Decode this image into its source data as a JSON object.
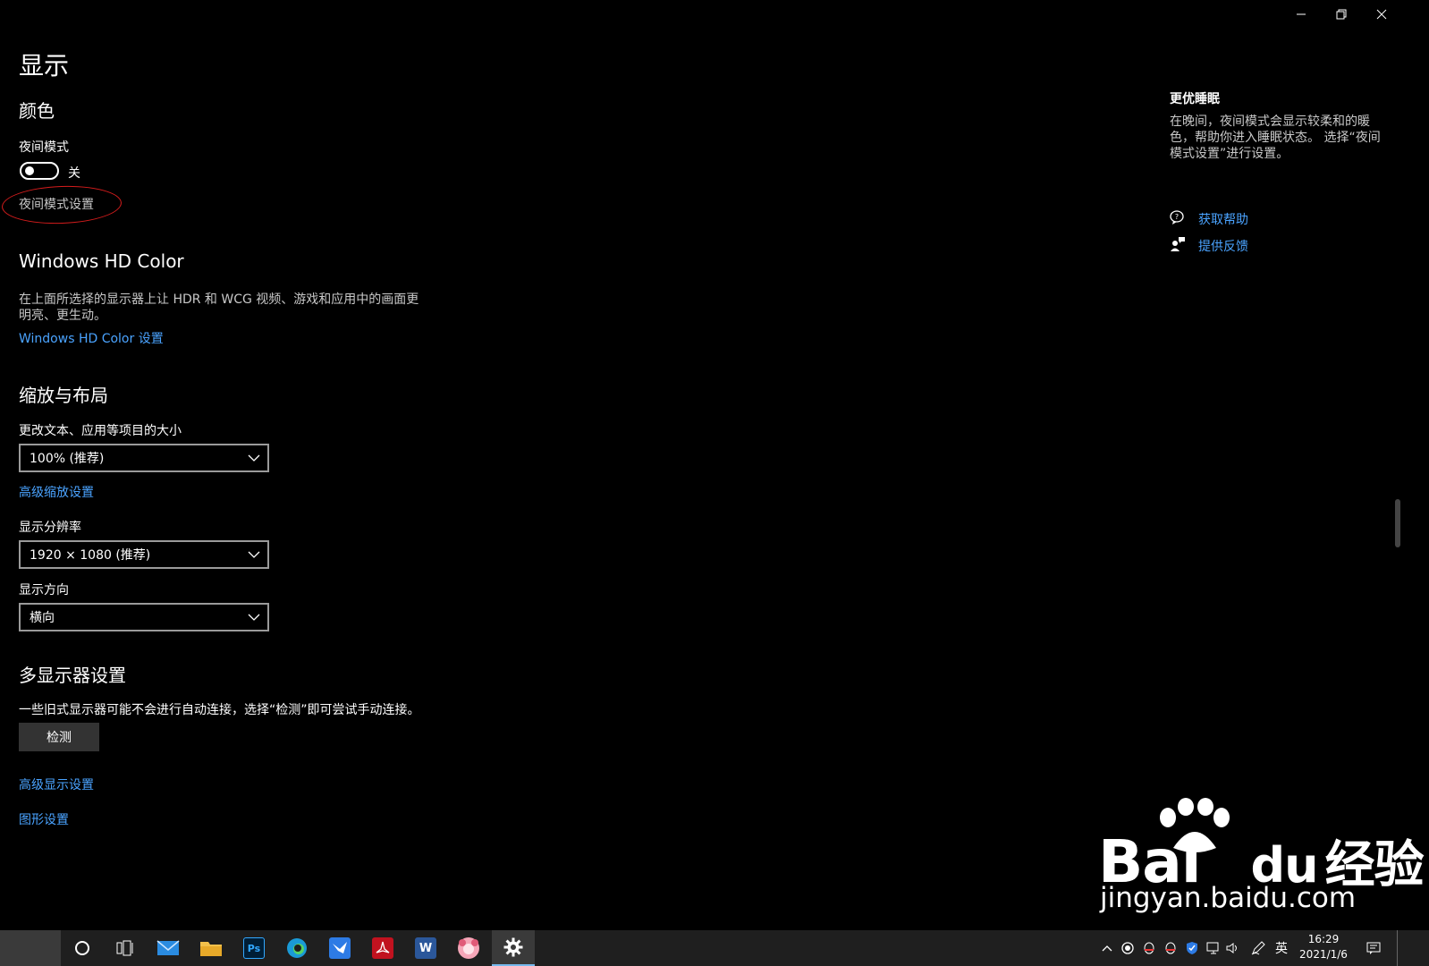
{
  "window": {
    "minimize_icon": "minimize-icon",
    "restore_icon": "restore-icon",
    "close_icon": "close-icon"
  },
  "page": {
    "title": "显示"
  },
  "color_section": {
    "heading": "颜色",
    "night_mode_label": "夜间模式",
    "night_mode_state": "关",
    "night_mode_settings_link": "夜间模式设置"
  },
  "hdr_section": {
    "heading": "Windows HD Color",
    "description_line1": "在上面所选择的显示器上让 HDR 和 WCG 视频、游戏和应用中的画面更",
    "description_line2": "明亮、更生动。",
    "settings_link": "Windows HD Color 设置"
  },
  "scale_section": {
    "heading": "缩放与布局",
    "text_size_label": "更改文本、应用等项目的大小",
    "text_size_value": "100% (推荐)",
    "advanced_scaling_link": "高级缩放设置",
    "resolution_label": "显示分辨率",
    "resolution_value": "1920 × 1080 (推荐)",
    "orientation_label": "显示方向",
    "orientation_value": "横向"
  },
  "multi_display_section": {
    "heading": "多显示器设置",
    "description": "一些旧式显示器可能不会进行自动连接，选择“检测”即可尝试手动连接。",
    "detect_button": "检测",
    "advanced_display_link": "高级显示设置",
    "graphics_settings_link": "图形设置"
  },
  "sidebar": {
    "heading": "更优睡眠",
    "description_line1": "在晚间，夜间模式会显示较柔和的暖",
    "description_line2": "色，帮助你进入睡眠状态。 选择“夜间",
    "description_line3": "模式设置”进行设置。",
    "help_link": "获取帮助",
    "feedback_link": "提供反馈"
  },
  "watermark": {
    "brand_latin": "Bai",
    "brand_du": "du",
    "brand_cn": "经验",
    "url": "jingyan.baidu.com"
  },
  "taskbar": {
    "apps": [
      "cortana",
      "task-view",
      "mail",
      "file-explorer",
      "photoshop",
      "edge",
      "feishu",
      "acrobat",
      "word",
      "avatar-app",
      "settings"
    ],
    "photoshop_label": "Ps",
    "word_label": "W",
    "ime_label": "英",
    "time": "16:29",
    "date": "2021/1/6"
  },
  "colors": {
    "accent_link": "#4aa3ff",
    "annotation_red": "#d41c1c",
    "taskbar_bg": "#1f1f1f"
  }
}
